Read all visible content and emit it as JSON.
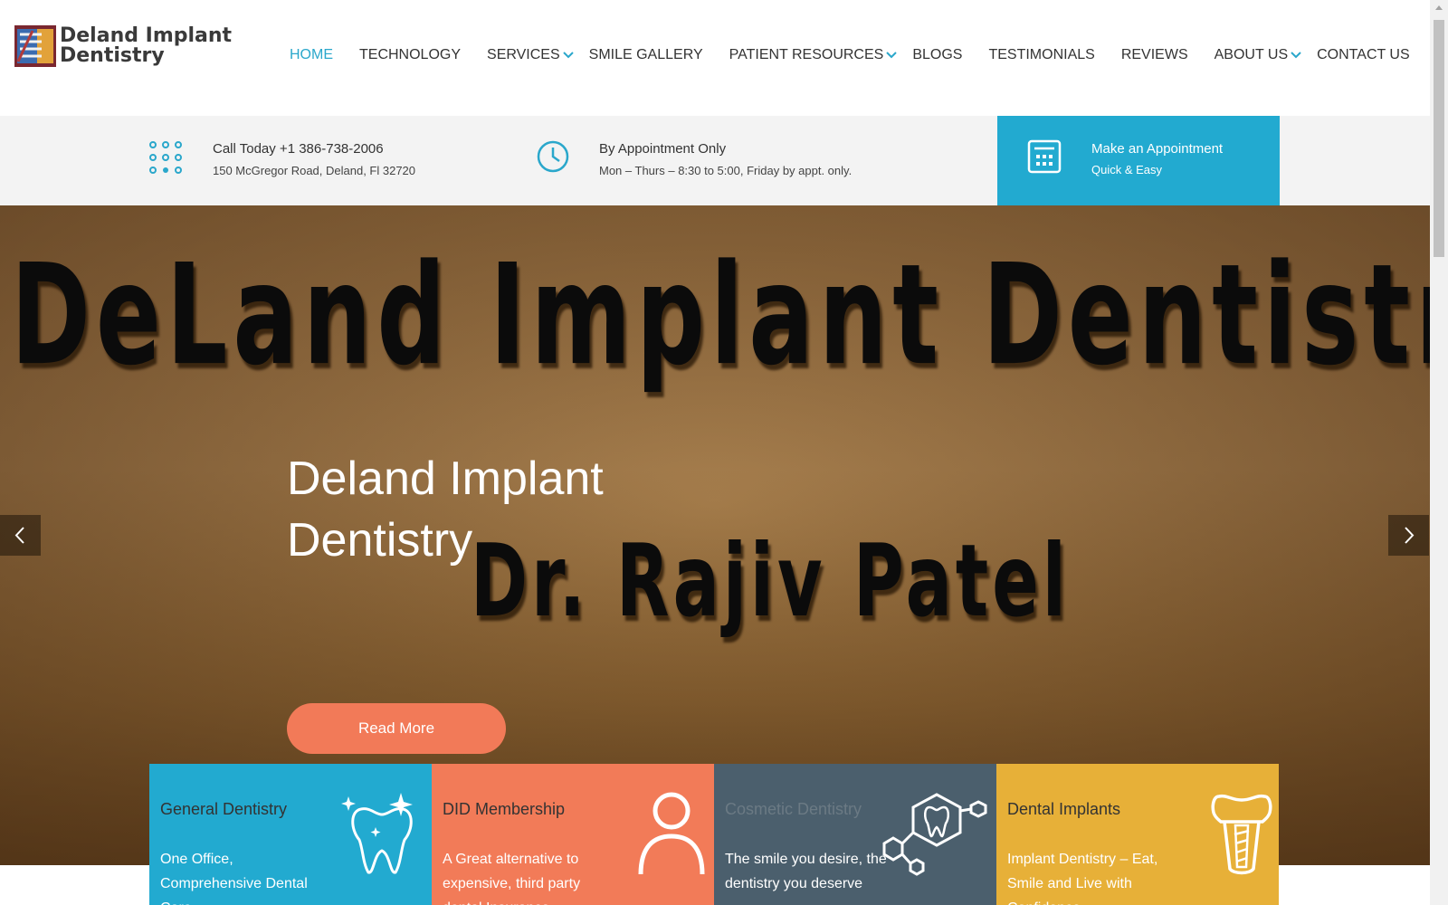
{
  "header": {
    "logo_line1": "Deland Implant",
    "logo_line2": "Dentistry",
    "nav": [
      {
        "label": "HOME",
        "active": true
      },
      {
        "label": "TECHNOLOGY"
      },
      {
        "label": "SERVICES",
        "has_submenu": true
      },
      {
        "label": "SMILE GALLERY"
      },
      {
        "label": "PATIENT RESOURCES",
        "has_submenu": true
      },
      {
        "label": "BLOGS"
      },
      {
        "label": "TESTIMONIALS"
      },
      {
        "label": "REVIEWS"
      },
      {
        "label": "ABOUT US",
        "has_submenu": true
      },
      {
        "label": "CONTACT US"
      }
    ]
  },
  "infobar": {
    "call": {
      "line1": "Call Today +1 386-738-2006",
      "line2": "150 McGregor Road, Deland, Fl 32720",
      "icon": "dialpad-icon"
    },
    "hours": {
      "line1": "By Appointment Only",
      "line2": "Mon – Thurs – 8:30 to 5:00, Friday by appt. only.",
      "icon": "clock-icon"
    },
    "appointment": {
      "line1": "Make an Appointment",
      "line2": "Quick & Easy",
      "icon": "calculator-icon"
    }
  },
  "hero": {
    "sign_line1": "DeLand Implant Dentistry",
    "sign_line2": "Dr. Rajiv Patel",
    "title_line1": "Deland Implant",
    "title_line2": "Dentistry",
    "button": "Read More"
  },
  "services": [
    {
      "title": "General Dentistry",
      "desc": "One Office, Comprehensive Dental Care",
      "bg": "#22aad0",
      "title_color": "#333333",
      "icon": "sparkling-tooth-icon"
    },
    {
      "title": "DID Membership",
      "desc": "A Great alternative to expensive, third party dental Insurance programs",
      "bg": "#f27b58",
      "title_color": "#333333",
      "icon": "person-icon"
    },
    {
      "title": "Cosmetic Dentistry",
      "desc": "The smile you desire, the dentistry you deserve",
      "bg": "#4b5f6d",
      "title_color": "#6b7a84",
      "icon": "tooth-molecule-icon"
    },
    {
      "title": "Dental Implants",
      "desc": "Implant Dentistry – Eat, Smile and Live with Confidence",
      "bg": "#e7b038",
      "title_color": "#333333",
      "icon": "dental-implant-icon"
    }
  ],
  "colors": {
    "accent": "#2aa7cb",
    "cta": "#f27a58"
  }
}
